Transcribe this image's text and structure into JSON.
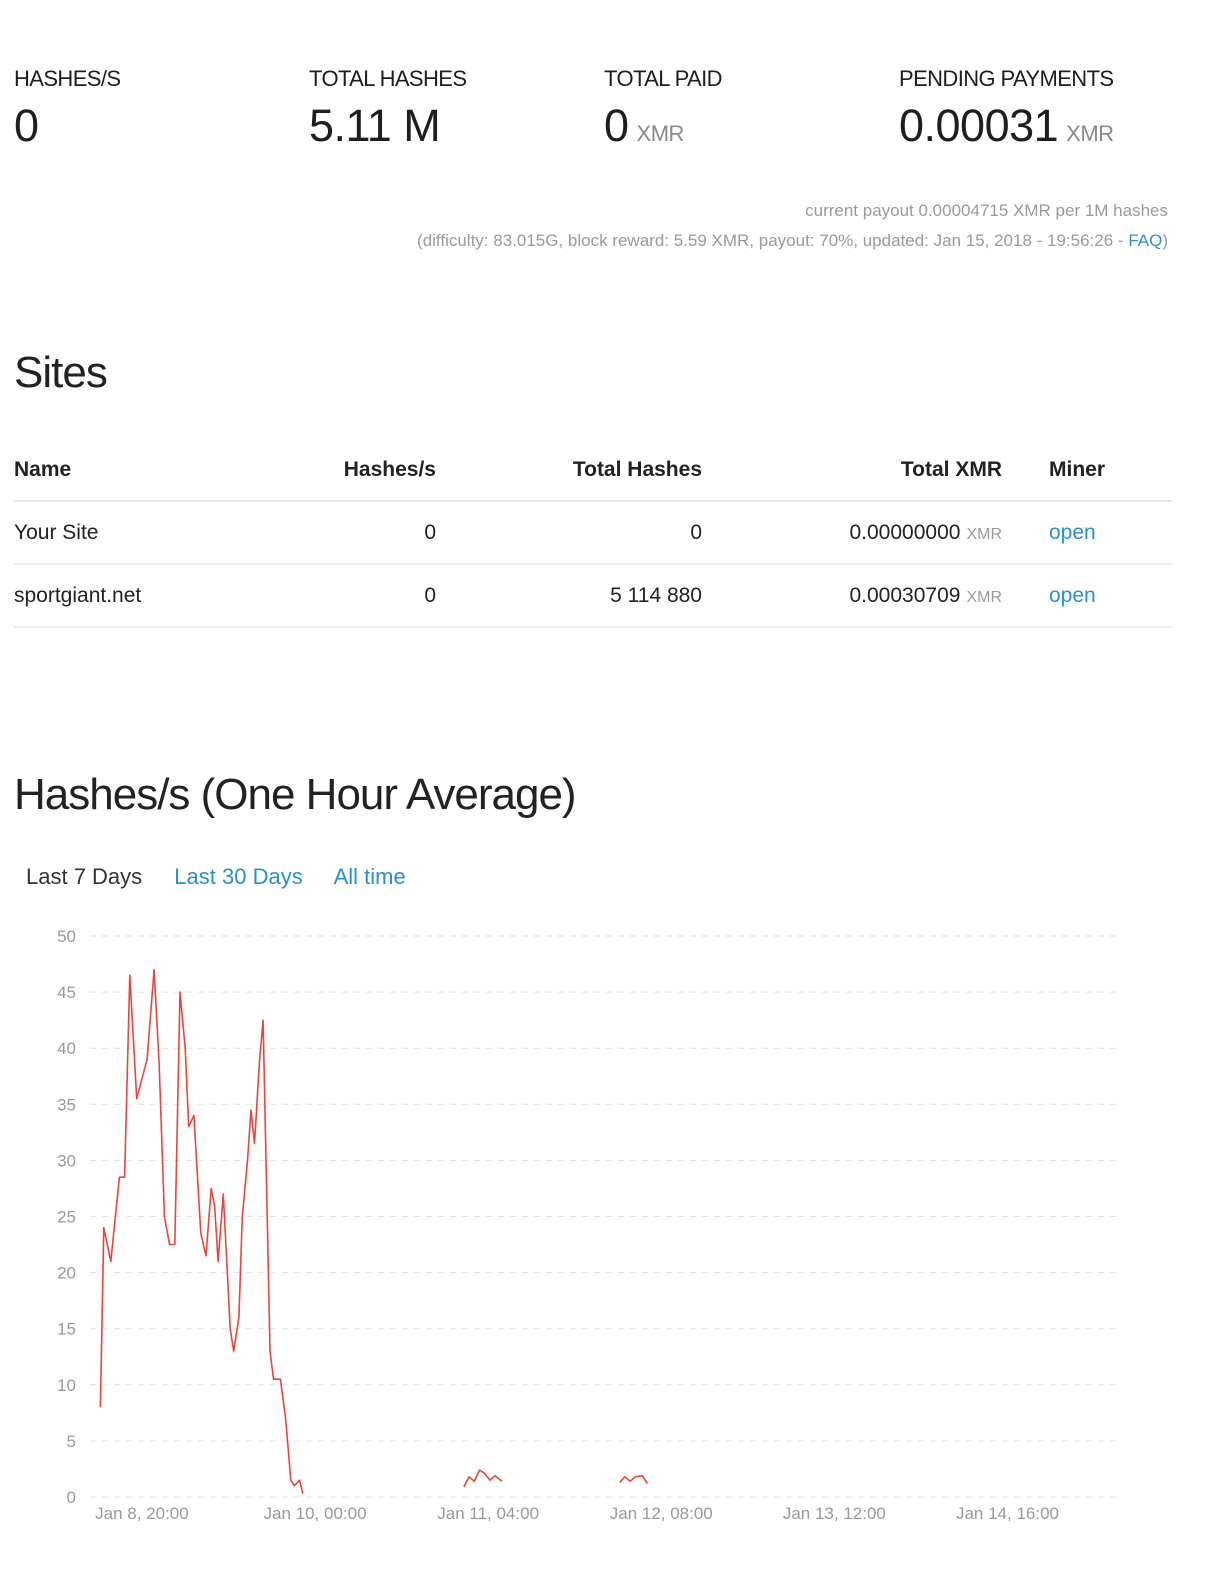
{
  "stats": {
    "hashes_per_sec": {
      "label": "HASHES/S",
      "value": "0"
    },
    "total_hashes": {
      "label": "TOTAL HASHES",
      "value": "5.11 M"
    },
    "total_paid": {
      "label": "TOTAL PAID",
      "value": "0",
      "unit": "XMR"
    },
    "pending_payments": {
      "label": "PENDING PAYMENTS",
      "value": "0.00031",
      "unit": "XMR"
    }
  },
  "payout": {
    "line1": "current payout 0.00004715 XMR per 1M hashes",
    "line2_prefix": "(difficulty: 83.015G, block reward: 5.59 XMR, payout: 70%, updated: Jan 15, 2018 - 19:56:26 - ",
    "faq_label": "FAQ",
    "line2_suffix": ")"
  },
  "sites": {
    "title": "Sites",
    "columns": [
      "Name",
      "Hashes/s",
      "Total Hashes",
      "Total XMR",
      "Miner"
    ],
    "rows": [
      {
        "name": "Your Site",
        "hashes_per_sec": "0",
        "total_hashes": "0",
        "total_xmr": "0.00000000",
        "unit": "XMR",
        "miner": "open"
      },
      {
        "name": "sportgiant.net",
        "hashes_per_sec": "0",
        "total_hashes": "5 114 880",
        "total_xmr": "0.00030709",
        "unit": "XMR",
        "miner": "open"
      }
    ]
  },
  "chart_section": {
    "title": "Hashes/s (One Hour Average)",
    "tabs": [
      "Last 7 Days",
      "Last 30 Days",
      "All time"
    ],
    "active_tab": "Last 7 Days"
  },
  "colors": {
    "line": "#e8463c",
    "accent": "#2a8fd2",
    "grid": "#e2e2e2"
  },
  "chart_data": {
    "type": "line",
    "ylim": [
      0,
      50
    ],
    "yticks": [
      0,
      5,
      10,
      15,
      20,
      25,
      30,
      35,
      40,
      45,
      50
    ],
    "xlim": [
      -0.3,
      5.65
    ],
    "xticks": [
      0,
      1,
      2,
      3,
      4,
      5
    ],
    "xtick_labels": [
      "Jan 8, 20:00",
      "Jan 10, 00:00",
      "Jan 11, 04:00",
      "Jan 12, 08:00",
      "Jan 13, 12:00",
      "Jan 14, 16:00"
    ],
    "grid": "horizontal dashed",
    "segments": [
      [
        [
          -0.24,
          8
        ],
        [
          -0.22,
          24
        ],
        [
          -0.18,
          21
        ],
        [
          -0.13,
          28.5
        ],
        [
          -0.1,
          28.5
        ],
        [
          -0.07,
          46.5
        ],
        [
          -0.03,
          35.5
        ],
        [
          0.03,
          39
        ],
        [
          0.07,
          47
        ],
        [
          0.1,
          38.5
        ],
        [
          0.13,
          25
        ],
        [
          0.16,
          22.5
        ],
        [
          0.19,
          22.5
        ],
        [
          0.22,
          45
        ],
        [
          0.25,
          40
        ],
        [
          0.27,
          33
        ],
        [
          0.3,
          34
        ],
        [
          0.34,
          23.5
        ],
        [
          0.37,
          21.5
        ],
        [
          0.4,
          27.5
        ],
        [
          0.42,
          26
        ],
        [
          0.44,
          21
        ],
        [
          0.47,
          27
        ],
        [
          0.51,
          15
        ],
        [
          0.53,
          13
        ],
        [
          0.56,
          16
        ],
        [
          0.58,
          25
        ],
        [
          0.61,
          30
        ],
        [
          0.63,
          34.5
        ],
        [
          0.65,
          31.5
        ],
        [
          0.68,
          39
        ],
        [
          0.7,
          42.5
        ],
        [
          0.74,
          13
        ],
        [
          0.76,
          10.5
        ],
        [
          0.8,
          10.5
        ],
        [
          0.83,
          7
        ],
        [
          0.86,
          1.5
        ],
        [
          0.88,
          1
        ],
        [
          0.91,
          1.5
        ],
        [
          0.93,
          0.3
        ]
      ],
      [
        [
          1.86,
          0.9
        ],
        [
          1.89,
          1.8
        ],
        [
          1.92,
          1.4
        ],
        [
          1.95,
          2.4
        ],
        [
          1.98,
          2.1
        ],
        [
          2.01,
          1.5
        ],
        [
          2.04,
          1.9
        ],
        [
          2.08,
          1.4
        ]
      ],
      [
        [
          2.76,
          1.3
        ],
        [
          2.79,
          1.8
        ],
        [
          2.82,
          1.4
        ],
        [
          2.85,
          1.8
        ],
        [
          2.89,
          1.9
        ],
        [
          2.92,
          1.2
        ]
      ]
    ]
  }
}
